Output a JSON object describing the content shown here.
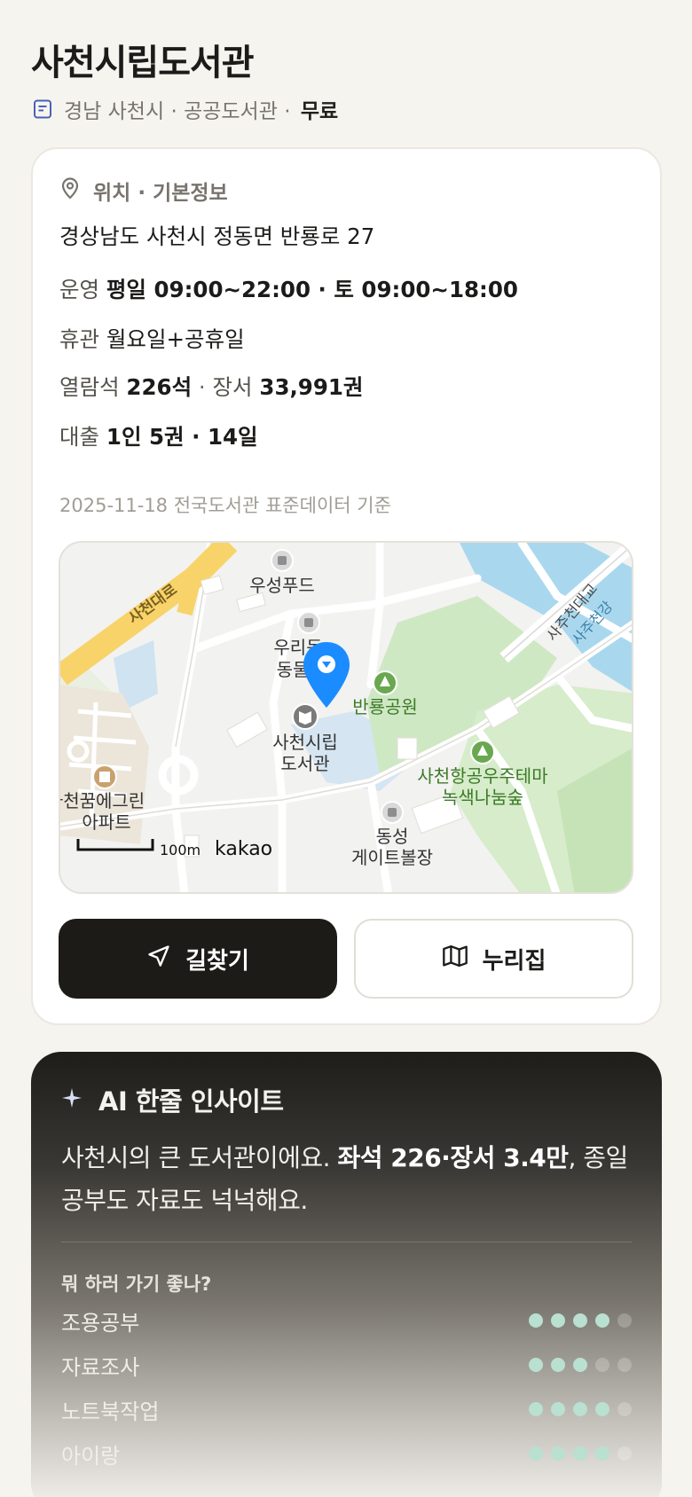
{
  "library": {
    "name": "사천시립도서관",
    "region": "경남 사천시",
    "type": "공공도서관",
    "fee": "무료",
    "sub_sep": "·"
  },
  "info": {
    "section_title": "위치 · 기본정보",
    "address": "경상남도 사천시 정동면 반룡로 27",
    "hours_label": "운영",
    "hours_value": "평일 09:00~22:00 · 토 09:00~18:00",
    "closed_label": "휴관",
    "closed_value": "월요일+공휴일",
    "seats_label": "열람석",
    "seats_value": "226석",
    "books_label": "장서",
    "books_value": "33,991권",
    "sep": "·",
    "loan_label": "대출",
    "loan_value": "1인 5권 · 14일",
    "source": "2025-11-18 전국도서관 표준데이터 기준"
  },
  "map": {
    "labels": {
      "road_main": "사천대로",
      "bridge": "사주천대교",
      "river": "사주천강",
      "poi_food": "우성푸드",
      "poi_hospital_1": "우리동",
      "poi_hospital_2": "동물",
      "park": "반룡공원",
      "library_1": "사천시립",
      "library_2": "도서관",
      "forest_1": "사천항공우주테마",
      "forest_2": "녹색나눔숲",
      "apt_1": "사천꿈에그린",
      "apt_2": "아파트",
      "golf_1": "동성",
      "golf_2": "게이트볼장",
      "scale": "100m",
      "brand": "kakao"
    },
    "colors": {
      "marker": "#1a8cff",
      "park": "#cfe8c4",
      "water": "#a9d8ee",
      "road": "#f8d36a"
    }
  },
  "actions": {
    "directions": "길찾기",
    "nurizip": "누리집"
  },
  "ai": {
    "title": "AI 한줄 인사이트",
    "text_pre": "사천시의 큰 도서관이에요. ",
    "text_bold": "좌석 226·장서 3.4만",
    "text_post": ", 종일 공부도 자료도 넉넉해요.",
    "question": "뭐 하러 가기 좋나?",
    "ratings": [
      {
        "label": "조용공부",
        "score": 4,
        "max": 5
      },
      {
        "label": "자료조사",
        "score": 3,
        "max": 5
      },
      {
        "label": "노트북작업",
        "score": 4,
        "max": 5
      },
      {
        "label": "아이랑",
        "score": 4,
        "max": 5
      }
    ]
  }
}
